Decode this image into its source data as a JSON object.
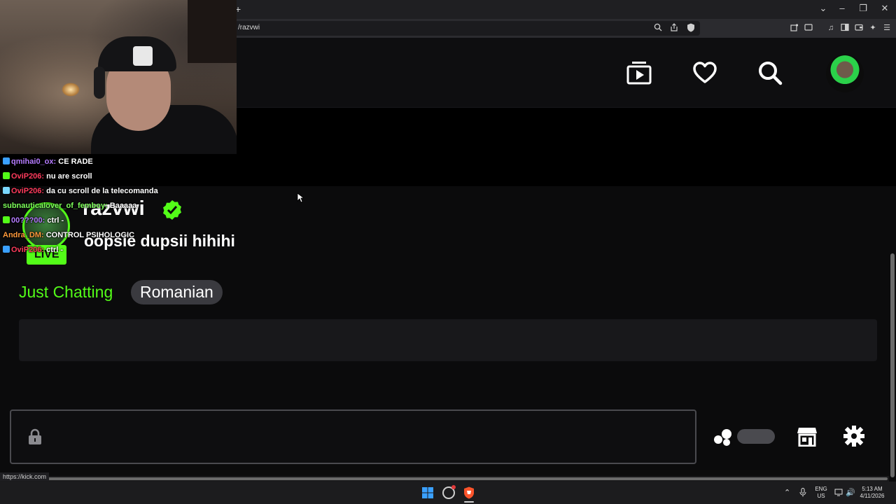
{
  "browser": {
    "new_tab_symbol": "+",
    "url": "/razvwi",
    "status_url": "https://kick.com"
  },
  "channel": {
    "name": "razvwi",
    "stream_title": "oopsie dupsii hihihi",
    "live_label": "LIVE",
    "category": "Just Chatting",
    "language": "Romanian"
  },
  "chat_overlay": [
    {
      "user": "qmihai0_ox:",
      "msg": "CE RADE",
      "color": "#b57bff"
    },
    {
      "user": "OviP206:",
      "msg": "nu are scroll",
      "color": "#ff3b5c"
    },
    {
      "user": "OviP206:",
      "msg": "da cu scroll de la telecomanda",
      "color": "#ff3b5c"
    },
    {
      "user": "subnauticalover_of_femboy:",
      "msg": "Baaaaa",
      "color": "#7dff5a"
    },
    {
      "user": "00???00:",
      "msg": "ctrl -",
      "color": "#b57bff"
    },
    {
      "user": "Andra_DM:",
      "msg": "CONTROL PSIHOLOGIC",
      "color": "#ff9a3c"
    },
    {
      "user": "OviP206:",
      "msg": "ctrl -",
      "color": "#ff3b5c"
    }
  ],
  "taskbar": {
    "lang_top": "ENG",
    "lang_bottom": "US",
    "time": "5:13 AM",
    "date": "4/11/2026"
  },
  "colors": {
    "accent": "#53fc18",
    "background": "#0b0b0c",
    "panel": "#18181b"
  },
  "icons": {
    "header": [
      "following-icon",
      "heart-icon",
      "search-icon",
      "avatar"
    ],
    "chat": [
      "lock-icon",
      "emote-icon",
      "store-icon",
      "settings-icon"
    ]
  }
}
